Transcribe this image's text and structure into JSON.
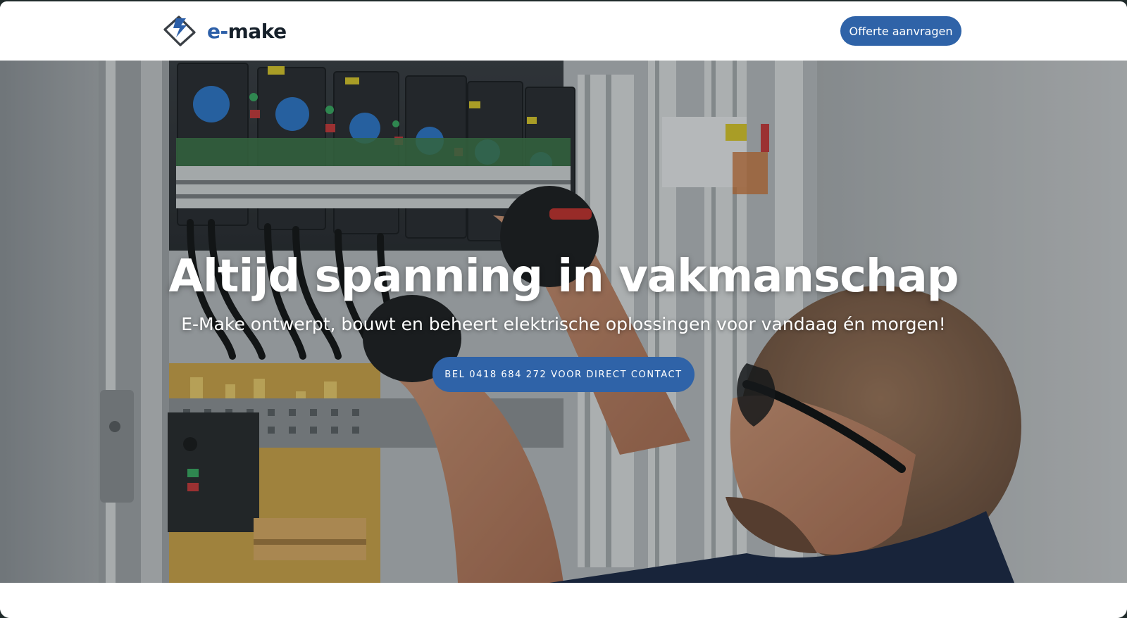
{
  "header": {
    "logo": {
      "prefix": "e-",
      "suffix": "make",
      "icon": "lightning-bolt-icon"
    },
    "cta_label": "Offerte aanvragen"
  },
  "hero": {
    "title": "Altijd spanning in vakmanschap",
    "subtitle": "E-Make ontwerpt, bouwt en beheert elektrische oplossingen voor vandaag én morgen!",
    "cta_label": "BEL 0418 684 272 VOOR DIRECT CONTACT",
    "image": "electrician-working-on-control-panel"
  },
  "colors": {
    "brand": "#2f63a8",
    "text_dark": "#16202a",
    "white": "#ffffff"
  }
}
